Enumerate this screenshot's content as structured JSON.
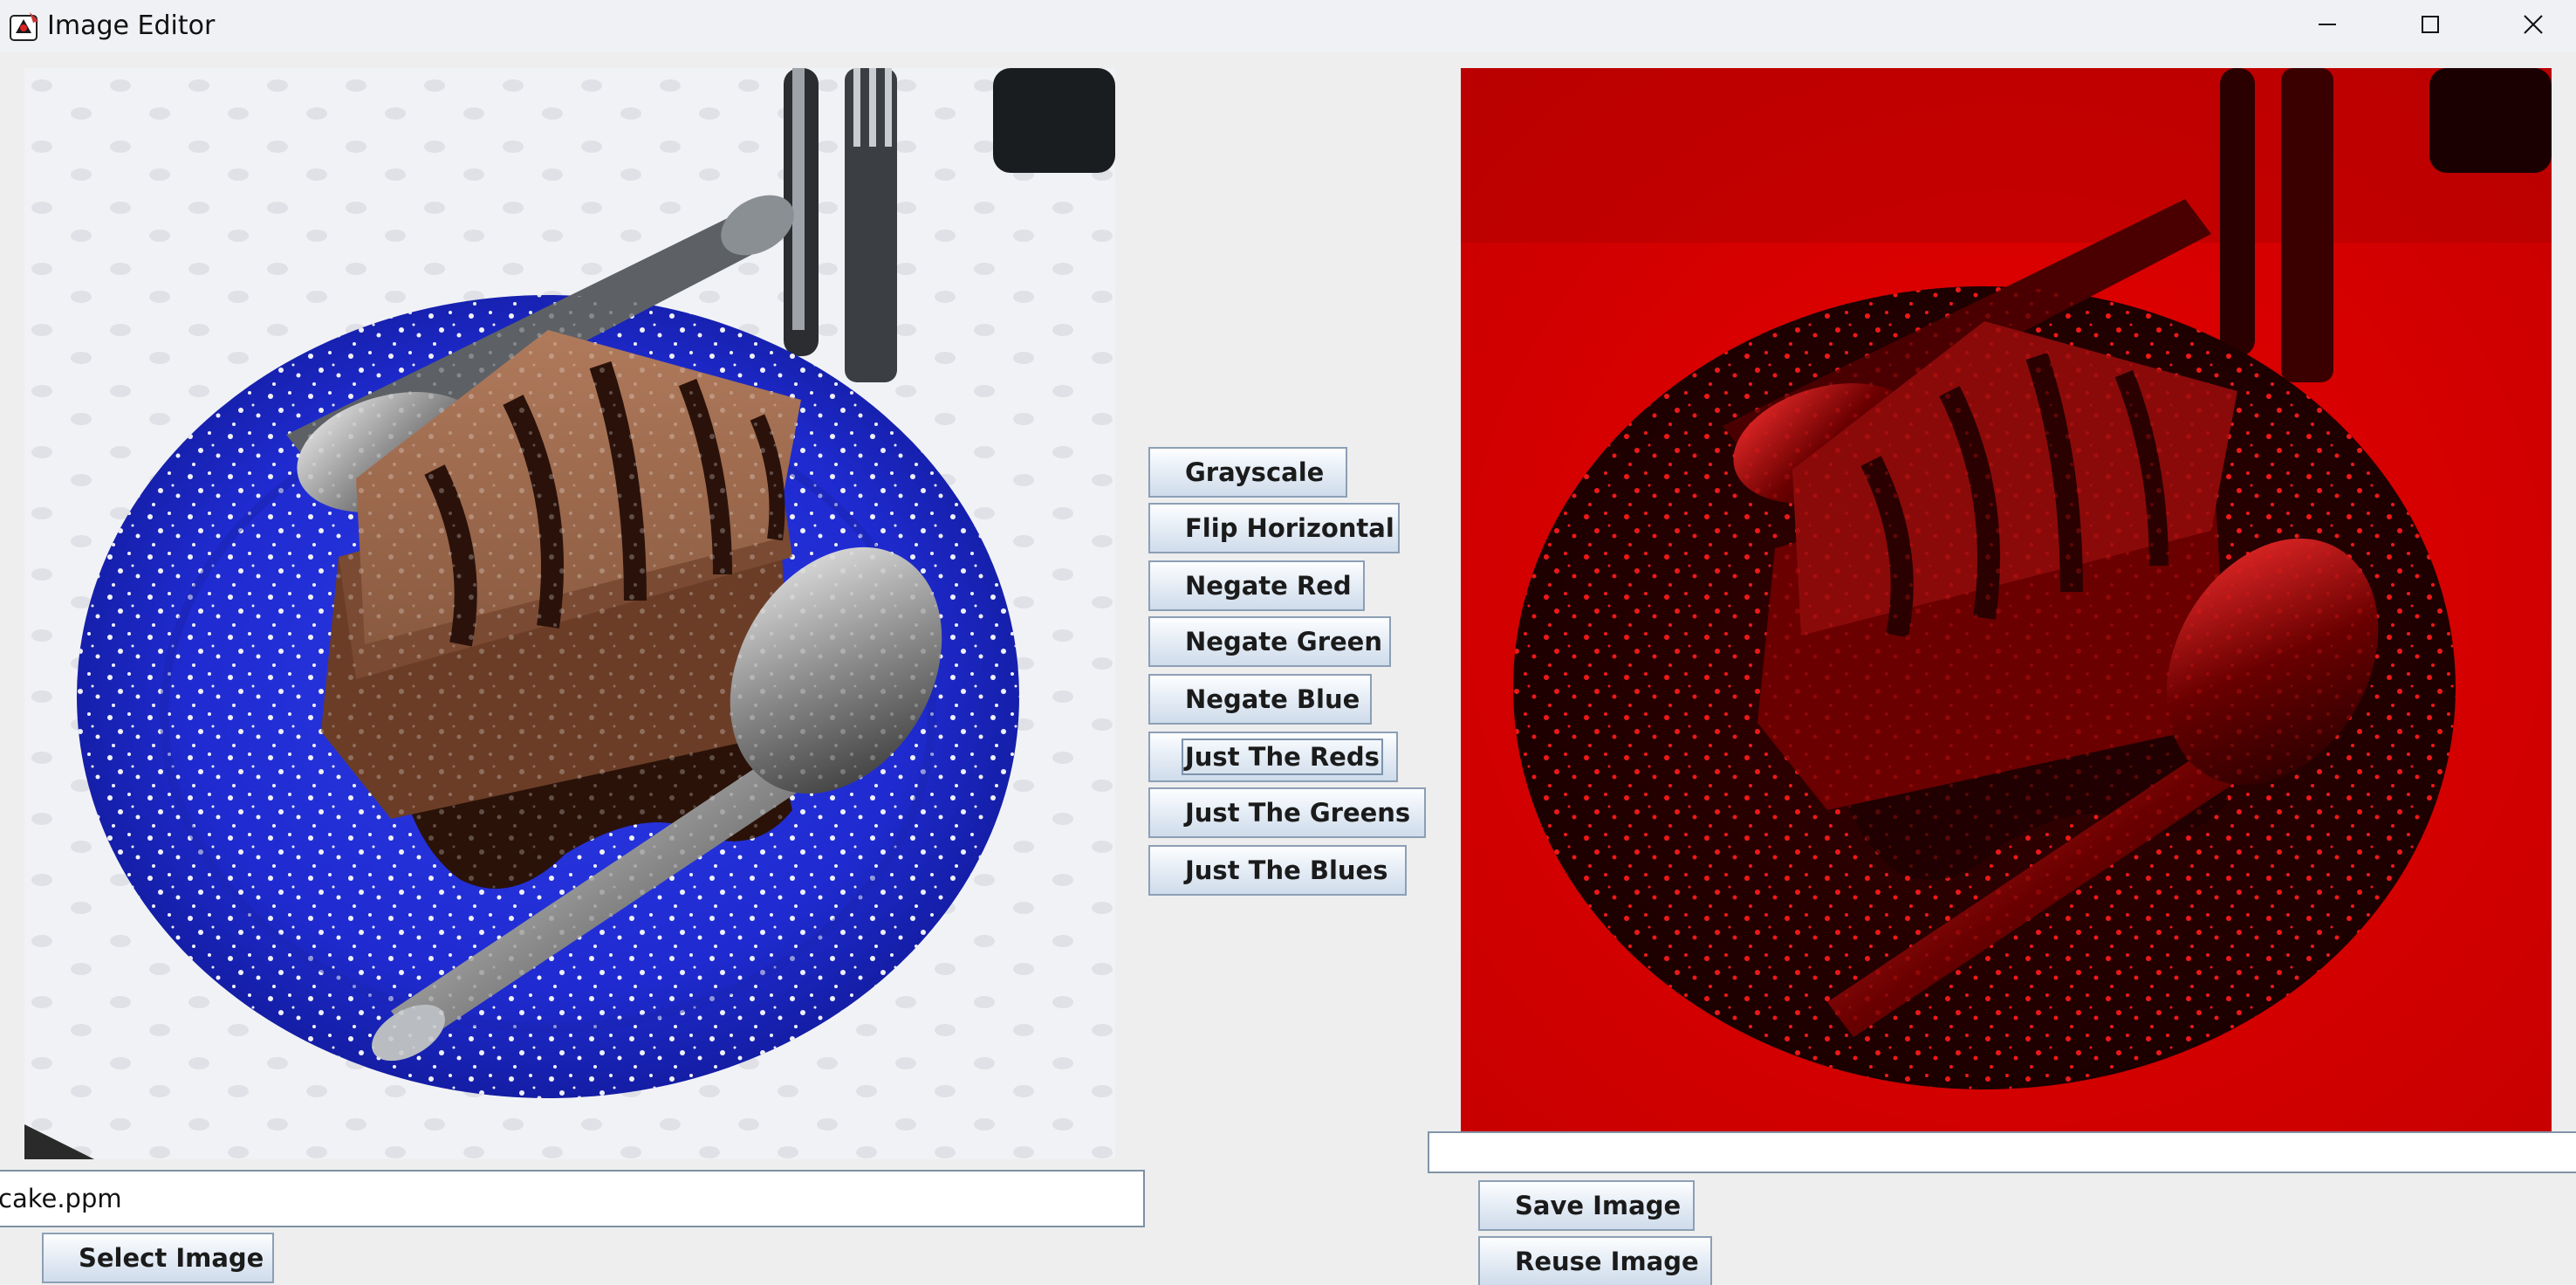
{
  "window": {
    "title": "Image Editor",
    "icon": "java-duke-icon",
    "controls": {
      "minimize_icon": "minimize-icon",
      "maximize_icon": "maximize-icon",
      "close_icon": "close-icon"
    }
  },
  "images": {
    "original": {
      "subject": "chocolate-cake-on-blue-plate",
      "tint": "full-color"
    },
    "edited": {
      "subject": "chocolate-cake-on-blue-plate",
      "tint": "red-channel-only",
      "color": "#e00000"
    }
  },
  "filters": [
    {
      "name": "grayscale-button",
      "label": "Grayscale"
    },
    {
      "name": "flip-horizontal-button",
      "label": "Flip Horizontal"
    },
    {
      "name": "negate-red-button",
      "label": "Negate Red"
    },
    {
      "name": "negate-green-button",
      "label": "Negate Green"
    },
    {
      "name": "negate-blue-button",
      "label": "Negate Blue"
    },
    {
      "name": "just-the-reds-button",
      "label": "Just The Reds",
      "focused": true
    },
    {
      "name": "just-the-greens-button",
      "label": "Just The Greens"
    },
    {
      "name": "just-the-blues-button",
      "label": "Just The Blues"
    }
  ],
  "file_path": {
    "value": "cake.ppm"
  },
  "output_path": {
    "value": ""
  },
  "actions": {
    "select_label": "Select Image",
    "save_label": "Save Image",
    "reuse_label": "Reuse Image"
  },
  "colors": {
    "button_border": "#8c9fb5",
    "background": "#eeeeee",
    "plate_blue": "#1f2fd6",
    "red_tint": "#e00000"
  }
}
